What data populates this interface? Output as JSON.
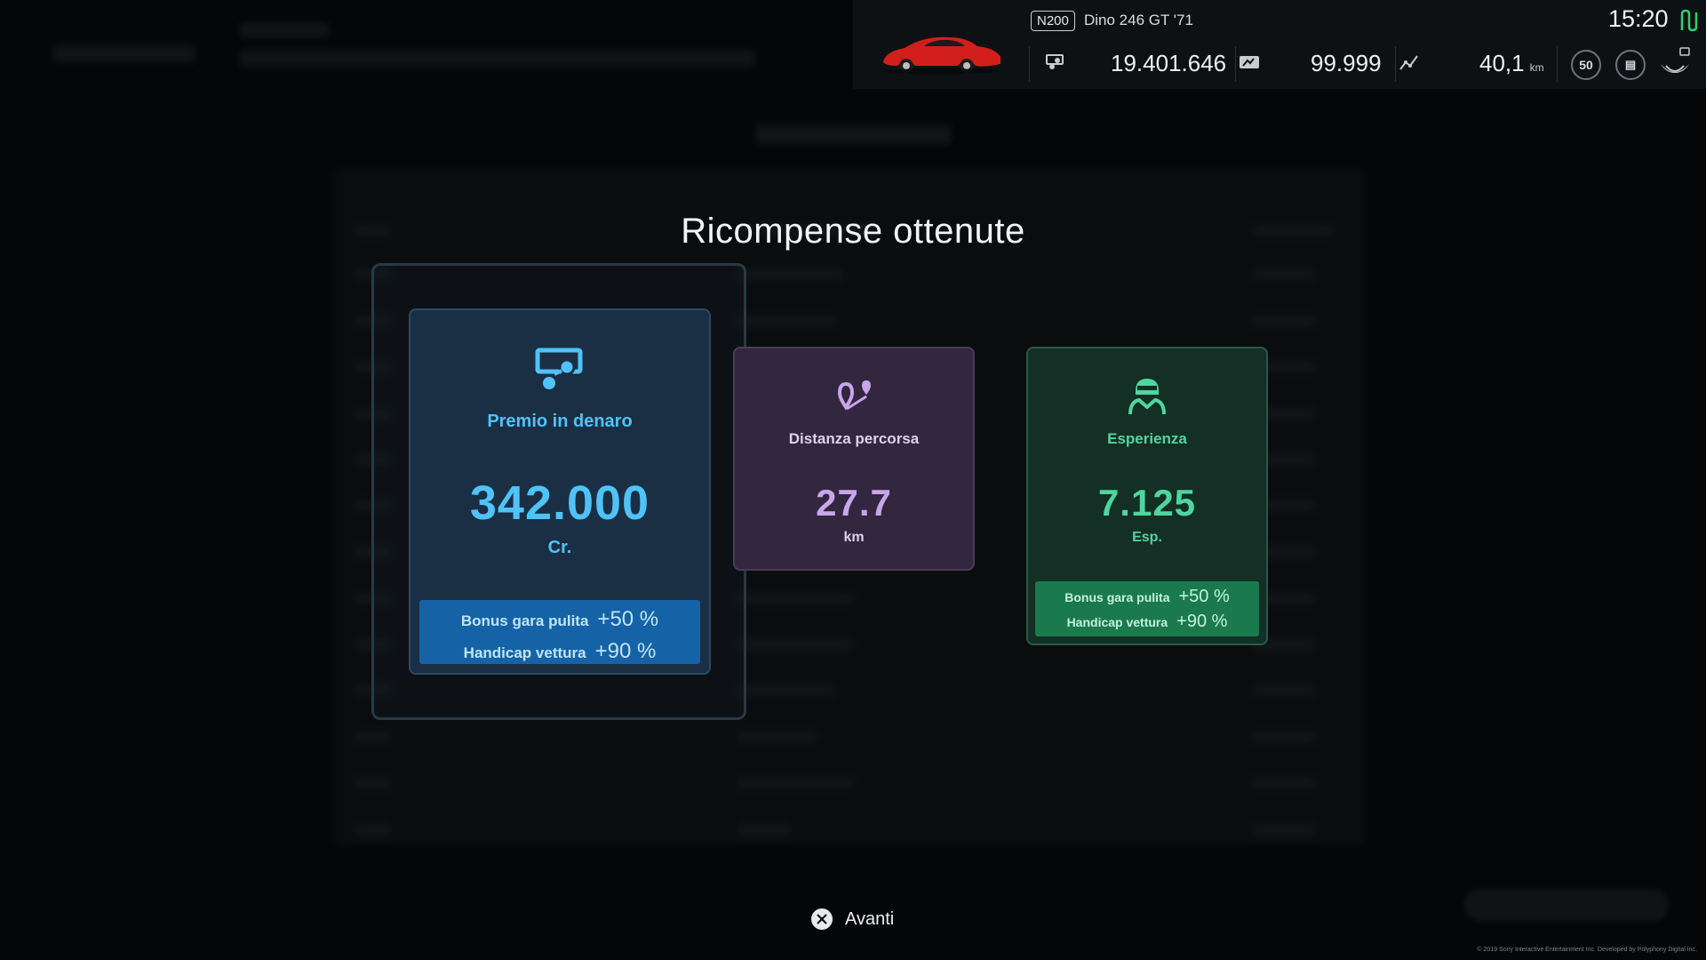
{
  "hud": {
    "car_class": "N200",
    "car_name": "Dino 246 GT '71",
    "credits": "19.401.646",
    "mileage_points": "99.999",
    "odometer": "40,1",
    "odometer_unit": "km",
    "level": "50",
    "time": "15:20",
    "icons": [
      "money-icon",
      "mileage-icon",
      "distance-graph-icon",
      "level-badge-icon",
      "manual-icon",
      "profile-emblem-icon",
      "connection-icon"
    ]
  },
  "modal": {
    "title": "Ricompense ottenute",
    "cards": {
      "money": {
        "icon": "money-icon",
        "label": "Premio in denaro",
        "value": "342.000",
        "unit": "Cr.",
        "bonuses": [
          {
            "label": "Bonus gara pulita",
            "value": "+50 %"
          },
          {
            "label": "Handicap vettura",
            "value": "+90 %"
          }
        ],
        "color": "#4fc3f7"
      },
      "distance": {
        "icon": "route-pin-icon",
        "label": "Distanza percorsa",
        "value": "27.7",
        "unit": "km",
        "color": "#c8a6ea"
      },
      "experience": {
        "icon": "driver-helmet-icon",
        "label": "Esperienza",
        "value": "7.125",
        "unit": "Esp.",
        "bonuses": [
          {
            "label": "Bonus gara pulita",
            "value": "+50 %"
          },
          {
            "label": "Handicap vettura",
            "value": "+90 %"
          }
        ],
        "color": "#4fd6a0"
      }
    }
  },
  "footer": {
    "continue_label": "Avanti",
    "copyright": "© 2019 Sony Interactive Entertainment Inc. Developed by Polyphony Digital Inc."
  }
}
